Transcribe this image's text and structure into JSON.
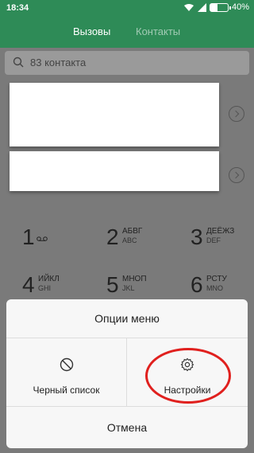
{
  "status": {
    "time": "18:34",
    "battery": "40%",
    "battery_level": 0.4
  },
  "tabs": [
    {
      "label": "Вызовы"
    },
    {
      "label": "Контакты"
    }
  ],
  "search": {
    "text": "83 контакта"
  },
  "keypad": {
    "keys": [
      {
        "num": "1",
        "letters": "",
        "latin": ""
      },
      {
        "num": "2",
        "letters": "АБВГ",
        "latin": "ABC"
      },
      {
        "num": "3",
        "letters": "ДЕЁЖЗ",
        "latin": "DEF"
      },
      {
        "num": "4",
        "letters": "ИЙКЛ",
        "latin": "GHI"
      },
      {
        "num": "5",
        "letters": "МНОП",
        "latin": "JKL"
      },
      {
        "num": "6",
        "letters": "РСТУ",
        "latin": "MNO"
      }
    ]
  },
  "menu": {
    "title": "Опции меню",
    "options": [
      {
        "label": "Черный список",
        "icon": "block-icon"
      },
      {
        "label": "Настройки",
        "icon": "gear-icon"
      }
    ],
    "cancel": "Отмена"
  },
  "colors": {
    "header": "#2e8b57",
    "highlight": "#e0201e"
  }
}
